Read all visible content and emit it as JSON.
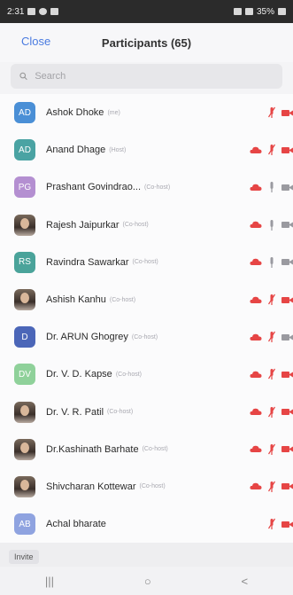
{
  "status_bar": {
    "time": "2:31",
    "battery": "35%"
  },
  "header": {
    "close_label": "Close",
    "title": "Participants (65)"
  },
  "search": {
    "placeholder": "Search"
  },
  "colors": {
    "accent": "#4a7be0",
    "muted_red": "#e64545",
    "icon_gray": "#9a9aa0"
  },
  "participants": [
    {
      "name": "Ashok Dhoke",
      "role": "(me)",
      "initials": "AD",
      "avatar_color": "#4a8fd6",
      "photo": false,
      "cloud": false,
      "mic": "muted",
      "video": "off"
    },
    {
      "name": "Anand Dhage",
      "role": "(Host)",
      "initials": "AD",
      "avatar_color": "#4aa3a3",
      "photo": false,
      "cloud": true,
      "mic": "muted",
      "video": "off"
    },
    {
      "name": "Prashant Govindrao...",
      "role": "(Co-host)",
      "initials": "PG",
      "avatar_color": "#b48fd1",
      "photo": false,
      "cloud": true,
      "mic": "on",
      "video": "on"
    },
    {
      "name": "Rajesh Jaipurkar",
      "role": "(Co-host)",
      "initials": "",
      "avatar_color": "#8a7060",
      "photo": true,
      "cloud": true,
      "mic": "on",
      "video": "on"
    },
    {
      "name": "Ravindra Sawarkar",
      "role": "(Co-host)",
      "initials": "RS",
      "avatar_color": "#4aa39a",
      "photo": false,
      "cloud": true,
      "mic": "on",
      "video": "on"
    },
    {
      "name": "Ashish Kanhu",
      "role": "(Co-host)",
      "initials": "",
      "avatar_color": "#3a3a40",
      "photo": true,
      "cloud": true,
      "mic": "muted",
      "video": "off"
    },
    {
      "name": "Dr. ARUN Ghogrey",
      "role": "(Co-host)",
      "initials": "D",
      "avatar_color": "#4b66b8",
      "photo": false,
      "cloud": true,
      "mic": "muted",
      "video": "on"
    },
    {
      "name": "Dr. V. D. Kapse",
      "role": "(Co-host)",
      "initials": "DV",
      "avatar_color": "#8fd19a",
      "photo": false,
      "cloud": true,
      "mic": "muted",
      "video": "off"
    },
    {
      "name": "Dr. V. R. Patil",
      "role": "(Co-host)",
      "initials": "",
      "avatar_color": "#2a2a2e",
      "photo": true,
      "cloud": true,
      "mic": "muted",
      "video": "off"
    },
    {
      "name": "Dr.Kashinath Barhate",
      "role": "(Co-host)",
      "initials": "",
      "avatar_color": "#8a3a3a",
      "photo": true,
      "cloud": true,
      "mic": "muted",
      "video": "off"
    },
    {
      "name": "Shivcharan Kottewar",
      "role": "(Co-host)",
      "initials": "",
      "avatar_color": "#9a3a4a",
      "photo": true,
      "cloud": true,
      "mic": "muted",
      "video": "off"
    },
    {
      "name": "Achal bharate",
      "role": "",
      "initials": "AB",
      "avatar_color": "#8fa3e0",
      "photo": false,
      "cloud": false,
      "mic": "muted",
      "video": "off"
    }
  ],
  "footer": {
    "invite_label": "Invite"
  },
  "nav": {
    "recents": "|||",
    "home": "○",
    "back": "<"
  }
}
